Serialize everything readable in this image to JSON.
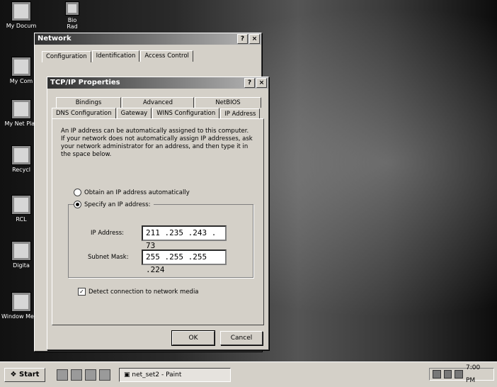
{
  "desktop": {
    "icons": [
      {
        "label": "My Docum",
        "icon": "folder-icon"
      },
      {
        "label": "My Com",
        "icon": "computer-icon"
      },
      {
        "label": "My Net Plac",
        "icon": "network-icon"
      },
      {
        "label": "Recycl",
        "icon": "recycle-bin-icon"
      },
      {
        "label": "RCL",
        "icon": "app-icon"
      },
      {
        "label": "Digita",
        "icon": "camera-icon"
      },
      {
        "label": "Window Media Player",
        "icon": "media-player-icon"
      }
    ],
    "top_icon_label": "Bio\nRad"
  },
  "network_window": {
    "title": "Network",
    "help_btn": "?",
    "close_btn": "×",
    "tabs": [
      "Configuration",
      "Identification",
      "Access Control"
    ]
  },
  "tcpip_dialog": {
    "title": "TCP/IP Properties",
    "help_btn": "?",
    "close_btn": "×",
    "tabs_row1": [
      "Bindings",
      "Advanced",
      "NetBIOS"
    ],
    "tabs_row2": [
      "DNS Configuration",
      "Gateway",
      "WINS Configuration",
      "IP Address"
    ],
    "description": "An IP address can be automatically assigned to this computer. If your network does not automatically assign IP addresses, ask your network administrator for an address, and then type it in the space below.",
    "radio_auto": "Obtain an IP address automatically",
    "radio_specify": "Specify an IP address:",
    "ip_label": "IP Address:",
    "ip_value": "211 .235 .243 . 73",
    "mask_label": "Subnet Mask:",
    "mask_value": "255 .255 .255 .224",
    "detect_label": "Detect connection to network media",
    "ok": "OK",
    "cancel": "Cancel"
  },
  "taskbar": {
    "start": "Start",
    "task_label": "net_set2 - Paint",
    "clock": "7:00 PM"
  }
}
